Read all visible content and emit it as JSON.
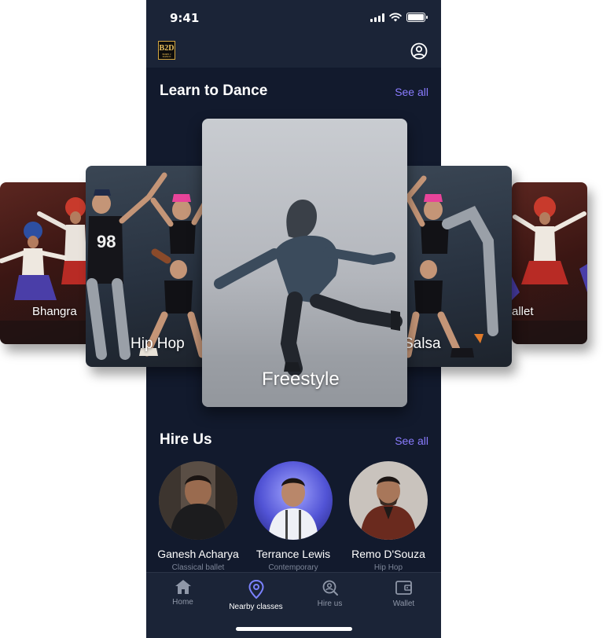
{
  "status_bar": {
    "time": "9:41"
  },
  "app_bar": {
    "logo_text": "B2D",
    "logo_subtext": "BORN 2 DANCE",
    "profile_icon": "profile-icon"
  },
  "learn_section": {
    "title": "Learn to Dance",
    "see_all": "See all",
    "styles": [
      {
        "label": "Bhangra"
      },
      {
        "label": "Hip Hop"
      },
      {
        "label": "Freestyle"
      },
      {
        "label": "Salsa"
      },
      {
        "label": "allet"
      }
    ]
  },
  "hire_section": {
    "title": "Hire Us",
    "see_all": "See all",
    "people": [
      {
        "name": "Ganesh Acharya",
        "role": "Classical ballet"
      },
      {
        "name": "Terrance Lewis",
        "role": "Contemporary"
      },
      {
        "name": "Remo D'Souza",
        "role": "Hip Hop"
      }
    ]
  },
  "bottom_nav": {
    "items": [
      {
        "label": "Home",
        "icon": "home-icon"
      },
      {
        "label": "Nearby classes",
        "icon": "location-pin-icon"
      },
      {
        "label": "Hire us",
        "icon": "search-person-icon"
      },
      {
        "label": "Wallet",
        "icon": "wallet-icon"
      }
    ],
    "active": "Nearby classes"
  },
  "colors": {
    "background": "#121a2d",
    "bar": "#1b2437",
    "accent": "#8a7cff",
    "muted_text": "#7d8699"
  }
}
